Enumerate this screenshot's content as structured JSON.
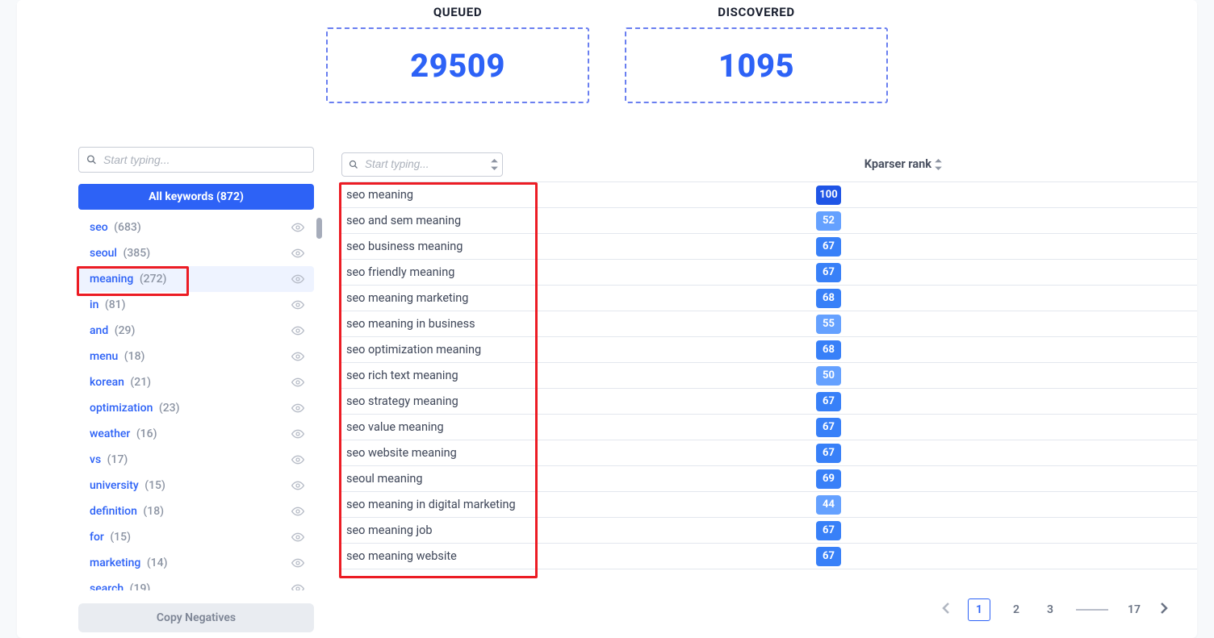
{
  "stats": {
    "queued_label": "QUEUED",
    "queued_value": "29509",
    "discovered_label": "DISCOVERED",
    "discovered_value": "1095"
  },
  "sidebar": {
    "search_placeholder": "Start typing...",
    "all_keywords_label": "All keywords (872)",
    "copy_negatives_label": "Copy Negatives",
    "items": [
      {
        "label": "seo",
        "count": "(683)"
      },
      {
        "label": "seoul",
        "count": "(385)"
      },
      {
        "label": "meaning",
        "count": "(272)",
        "selected": true
      },
      {
        "label": "in",
        "count": "(81)"
      },
      {
        "label": "and",
        "count": "(29)"
      },
      {
        "label": "menu",
        "count": "(18)"
      },
      {
        "label": "korean",
        "count": "(21)"
      },
      {
        "label": "optimization",
        "count": "(23)"
      },
      {
        "label": "weather",
        "count": "(16)"
      },
      {
        "label": "vs",
        "count": "(17)"
      },
      {
        "label": "university",
        "count": "(15)"
      },
      {
        "label": "definition",
        "count": "(18)"
      },
      {
        "label": "for",
        "count": "(15)"
      },
      {
        "label": "marketing",
        "count": "(14)"
      },
      {
        "label": "search",
        "count": "(19)"
      }
    ]
  },
  "main": {
    "search_placeholder": "Start typing...",
    "rank_header": "Kparser rank",
    "rows": [
      {
        "text": "seo meaning",
        "rank": "100",
        "dark": true
      },
      {
        "text": "seo and sem meaning",
        "rank": "52",
        "alt": true
      },
      {
        "text": "seo business meaning",
        "rank": "67"
      },
      {
        "text": "seo friendly meaning",
        "rank": "67"
      },
      {
        "text": "seo meaning marketing",
        "rank": "68"
      },
      {
        "text": "seo meaning in business",
        "rank": "55",
        "alt": true
      },
      {
        "text": "seo optimization meaning",
        "rank": "68"
      },
      {
        "text": "seo rich text meaning",
        "rank": "50",
        "alt": true
      },
      {
        "text": "seo strategy meaning",
        "rank": "67"
      },
      {
        "text": "seo value meaning",
        "rank": "67"
      },
      {
        "text": "seo website meaning",
        "rank": "67"
      },
      {
        "text": "seoul meaning",
        "rank": "69"
      },
      {
        "text": "seo meaning in digital marketing",
        "rank": "44",
        "alt": true
      },
      {
        "text": "seo meaning job",
        "rank": "67"
      },
      {
        "text": "seo meaning website",
        "rank": "67"
      }
    ]
  },
  "pagination": {
    "current": "1",
    "p2": "2",
    "p3": "3",
    "last": "17"
  }
}
